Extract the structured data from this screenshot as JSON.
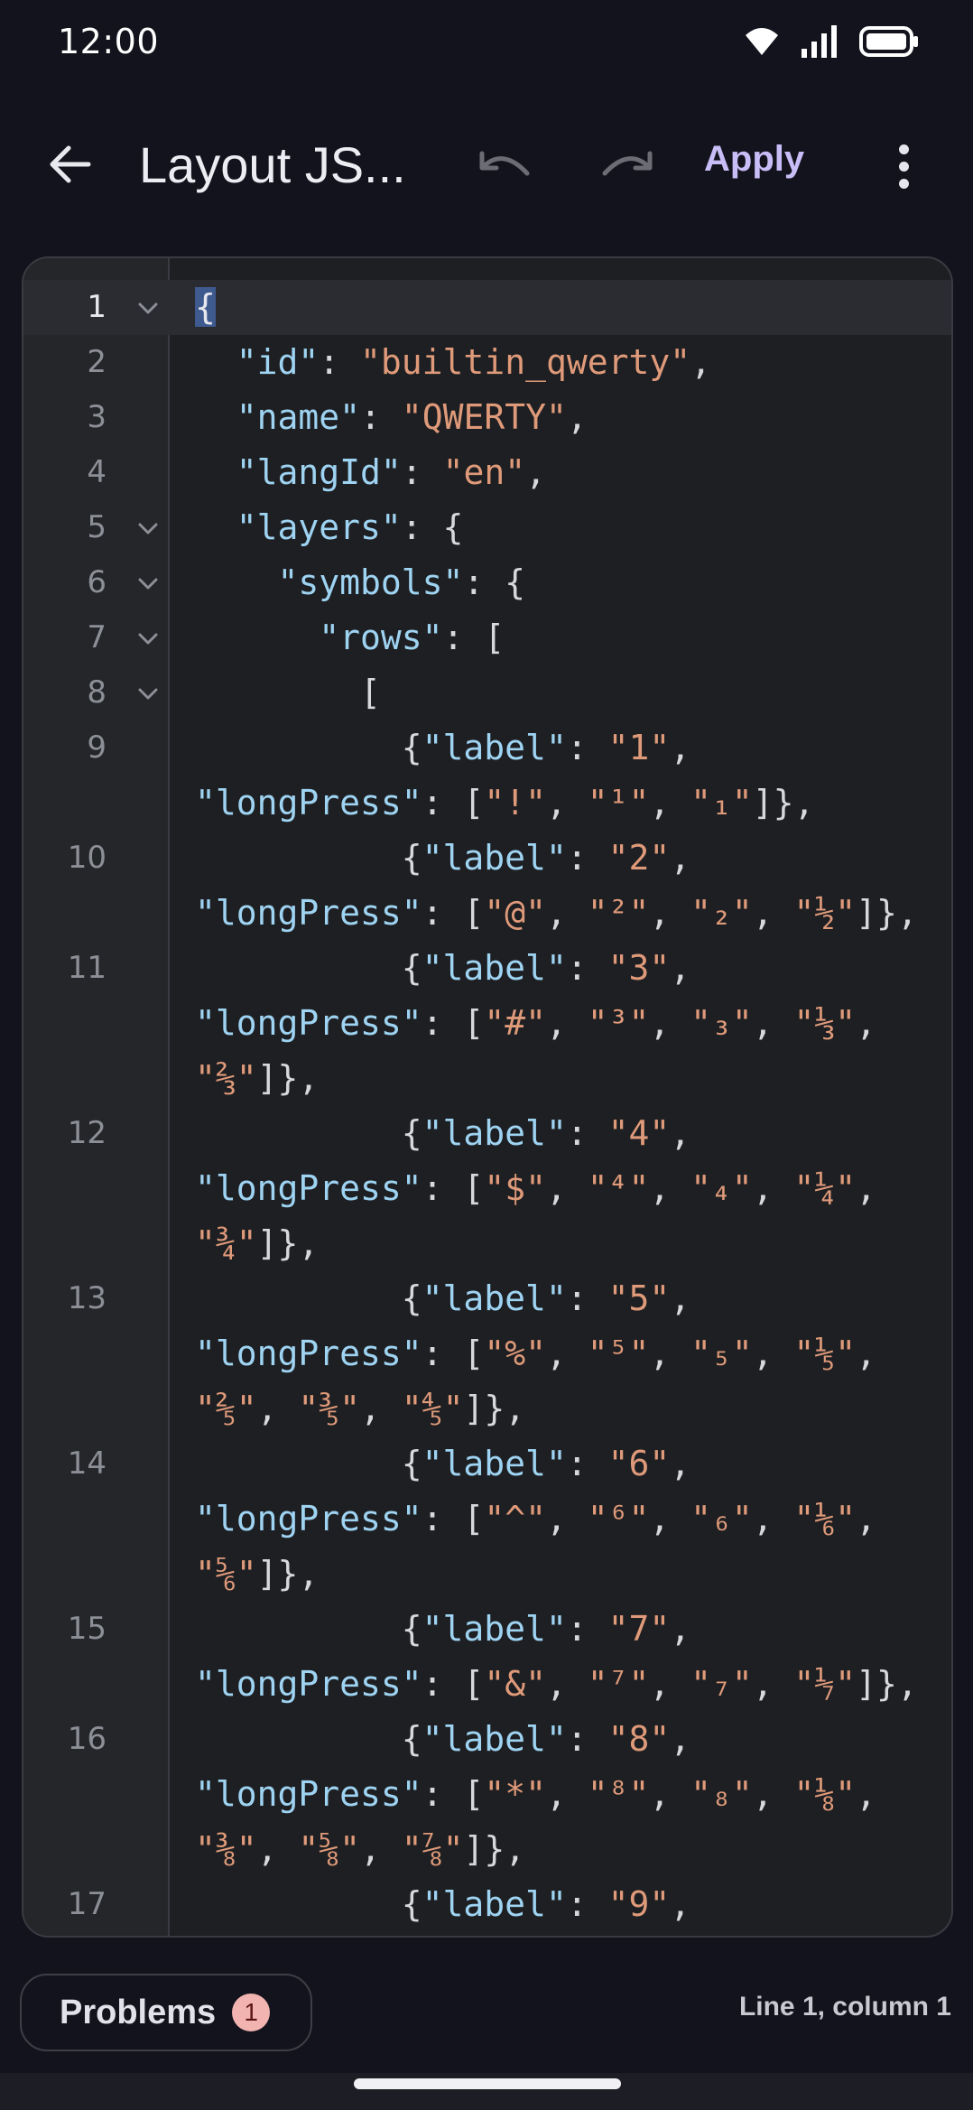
{
  "status_bar": {
    "time": "12:00",
    "icons": [
      "wifi-icon",
      "signal-icon",
      "battery-icon"
    ]
  },
  "app_bar": {
    "title": "Layout JS...",
    "apply_label": "Apply",
    "icons": [
      "arrow-back-icon",
      "undo-icon",
      "redo-icon",
      "more-vertical-icon"
    ]
  },
  "colors": {
    "background": "#13131d",
    "editor_bg": "#1e1f22",
    "gutter_bg": "#25262a",
    "json_key": "#9ed3f2",
    "json_string": "#df9a7a",
    "accent": "#c9bdf7",
    "badge": "#f2b4b0"
  },
  "editor": {
    "lines": [
      {
        "num": "1",
        "fold": true,
        "active": true,
        "wrapped_rows": 1,
        "tokens": [
          {
            "t": "{",
            "c": "caret"
          }
        ]
      },
      {
        "num": "2",
        "fold": false,
        "wrapped_rows": 1,
        "tokens": [
          {
            "t": "  ",
            "c": "p"
          },
          {
            "t": "\"id\"",
            "c": "k"
          },
          {
            "t": ": ",
            "c": "p"
          },
          {
            "t": "\"builtin_qwerty\"",
            "c": "s"
          },
          {
            "t": ",",
            "c": "p"
          }
        ]
      },
      {
        "num": "3",
        "fold": false,
        "wrapped_rows": 1,
        "tokens": [
          {
            "t": "  ",
            "c": "p"
          },
          {
            "t": "\"name\"",
            "c": "k"
          },
          {
            "t": ": ",
            "c": "p"
          },
          {
            "t": "\"QWERTY\"",
            "c": "s"
          },
          {
            "t": ",",
            "c": "p"
          }
        ]
      },
      {
        "num": "4",
        "fold": false,
        "wrapped_rows": 1,
        "tokens": [
          {
            "t": "  ",
            "c": "p"
          },
          {
            "t": "\"langId\"",
            "c": "k"
          },
          {
            "t": ": ",
            "c": "p"
          },
          {
            "t": "\"en\"",
            "c": "s"
          },
          {
            "t": ",",
            "c": "p"
          }
        ]
      },
      {
        "num": "5",
        "fold": true,
        "wrapped_rows": 1,
        "tokens": [
          {
            "t": "  ",
            "c": "p"
          },
          {
            "t": "\"layers\"",
            "c": "k"
          },
          {
            "t": ": {",
            "c": "p"
          }
        ]
      },
      {
        "num": "6",
        "fold": true,
        "wrapped_rows": 1,
        "tokens": [
          {
            "t": "    ",
            "c": "p"
          },
          {
            "t": "\"symbols\"",
            "c": "k"
          },
          {
            "t": ": {",
            "c": "p"
          }
        ]
      },
      {
        "num": "7",
        "fold": true,
        "wrapped_rows": 1,
        "tokens": [
          {
            "t": "      ",
            "c": "p"
          },
          {
            "t": "\"rows\"",
            "c": "k"
          },
          {
            "t": ": [",
            "c": "p"
          }
        ]
      },
      {
        "num": "8",
        "fold": true,
        "wrapped_rows": 1,
        "tokens": [
          {
            "t": "        [",
            "c": "p"
          }
        ]
      },
      {
        "num": "9",
        "fold": false,
        "wrapped_rows": 2,
        "tokens": [
          {
            "t": "          {",
            "c": "p"
          },
          {
            "t": "\"label\"",
            "c": "k"
          },
          {
            "t": ": ",
            "c": "p"
          },
          {
            "t": "\"1\"",
            "c": "s"
          },
          {
            "t": ", ",
            "c": "p"
          },
          {
            "t": "\"longPress\"",
            "c": "k"
          },
          {
            "t": ": [",
            "c": "p"
          },
          {
            "t": "\"!\"",
            "c": "s"
          },
          {
            "t": ", ",
            "c": "p"
          },
          {
            "t": "\"¹\"",
            "c": "s"
          },
          {
            "t": ", ",
            "c": "p"
          },
          {
            "t": "\"₁\"",
            "c": "s"
          },
          {
            "t": "]},",
            "c": "p"
          }
        ]
      },
      {
        "num": "10",
        "fold": false,
        "wrapped_rows": 2,
        "tokens": [
          {
            "t": "          {",
            "c": "p"
          },
          {
            "t": "\"label\"",
            "c": "k"
          },
          {
            "t": ": ",
            "c": "p"
          },
          {
            "t": "\"2\"",
            "c": "s"
          },
          {
            "t": ", ",
            "c": "p"
          },
          {
            "t": "\"longPress\"",
            "c": "k"
          },
          {
            "t": ": [",
            "c": "p"
          },
          {
            "t": "\"@\"",
            "c": "s"
          },
          {
            "t": ", ",
            "c": "p"
          },
          {
            "t": "\"²\"",
            "c": "s"
          },
          {
            "t": ", ",
            "c": "p"
          },
          {
            "t": "\"₂\"",
            "c": "s"
          },
          {
            "t": ", ",
            "c": "p"
          },
          {
            "t": "\"½\"",
            "c": "s"
          },
          {
            "t": "]},",
            "c": "p"
          }
        ]
      },
      {
        "num": "11",
        "fold": false,
        "wrapped_rows": 3,
        "tokens": [
          {
            "t": "          {",
            "c": "p"
          },
          {
            "t": "\"label\"",
            "c": "k"
          },
          {
            "t": ": ",
            "c": "p"
          },
          {
            "t": "\"3\"",
            "c": "s"
          },
          {
            "t": ", ",
            "c": "p"
          },
          {
            "t": "\"longPress\"",
            "c": "k"
          },
          {
            "t": ": [",
            "c": "p"
          },
          {
            "t": "\"#\"",
            "c": "s"
          },
          {
            "t": ", ",
            "c": "p"
          },
          {
            "t": "\"³\"",
            "c": "s"
          },
          {
            "t": ", ",
            "c": "p"
          },
          {
            "t": "\"₃\"",
            "c": "s"
          },
          {
            "t": ", ",
            "c": "p"
          },
          {
            "t": "\"⅓\"",
            "c": "s"
          },
          {
            "t": ", ",
            "c": "p"
          },
          {
            "t": "\"⅔\"",
            "c": "s"
          },
          {
            "t": "]},",
            "c": "p"
          }
        ]
      },
      {
        "num": "12",
        "fold": false,
        "wrapped_rows": 3,
        "tokens": [
          {
            "t": "          {",
            "c": "p"
          },
          {
            "t": "\"label\"",
            "c": "k"
          },
          {
            "t": ": ",
            "c": "p"
          },
          {
            "t": "\"4\"",
            "c": "s"
          },
          {
            "t": ", ",
            "c": "p"
          },
          {
            "t": "\"longPress\"",
            "c": "k"
          },
          {
            "t": ": [",
            "c": "p"
          },
          {
            "t": "\"$\"",
            "c": "s"
          },
          {
            "t": ", ",
            "c": "p"
          },
          {
            "t": "\"⁴\"",
            "c": "s"
          },
          {
            "t": ", ",
            "c": "p"
          },
          {
            "t": "\"₄\"",
            "c": "s"
          },
          {
            "t": ", ",
            "c": "p"
          },
          {
            "t": "\"¼\"",
            "c": "s"
          },
          {
            "t": ", ",
            "c": "p"
          },
          {
            "t": "\"¾\"",
            "c": "s"
          },
          {
            "t": "]},",
            "c": "p"
          }
        ]
      },
      {
        "num": "13",
        "fold": false,
        "wrapped_rows": 3,
        "tokens": [
          {
            "t": "          {",
            "c": "p"
          },
          {
            "t": "\"label\"",
            "c": "k"
          },
          {
            "t": ": ",
            "c": "p"
          },
          {
            "t": "\"5\"",
            "c": "s"
          },
          {
            "t": ", ",
            "c": "p"
          },
          {
            "t": "\"longPress\"",
            "c": "k"
          },
          {
            "t": ": [",
            "c": "p"
          },
          {
            "t": "\"%\"",
            "c": "s"
          },
          {
            "t": ", ",
            "c": "p"
          },
          {
            "t": "\"⁵\"",
            "c": "s"
          },
          {
            "t": ", ",
            "c": "p"
          },
          {
            "t": "\"₅\"",
            "c": "s"
          },
          {
            "t": ", ",
            "c": "p"
          },
          {
            "t": "\"⅕\"",
            "c": "s"
          },
          {
            "t": ", ",
            "c": "p"
          },
          {
            "t": "\"⅖\"",
            "c": "s"
          },
          {
            "t": ", ",
            "c": "p"
          },
          {
            "t": "\"⅗\"",
            "c": "s"
          },
          {
            "t": ", ",
            "c": "p"
          },
          {
            "t": "\"⅘\"",
            "c": "s"
          },
          {
            "t": "]},",
            "c": "p"
          }
        ]
      },
      {
        "num": "14",
        "fold": false,
        "wrapped_rows": 3,
        "tokens": [
          {
            "t": "          {",
            "c": "p"
          },
          {
            "t": "\"label\"",
            "c": "k"
          },
          {
            "t": ": ",
            "c": "p"
          },
          {
            "t": "\"6\"",
            "c": "s"
          },
          {
            "t": ", ",
            "c": "p"
          },
          {
            "t": "\"longPress\"",
            "c": "k"
          },
          {
            "t": ": [",
            "c": "p"
          },
          {
            "t": "\"^\"",
            "c": "s"
          },
          {
            "t": ", ",
            "c": "p"
          },
          {
            "t": "\"⁶\"",
            "c": "s"
          },
          {
            "t": ", ",
            "c": "p"
          },
          {
            "t": "\"₆\"",
            "c": "s"
          },
          {
            "t": ", ",
            "c": "p"
          },
          {
            "t": "\"⅙\"",
            "c": "s"
          },
          {
            "t": ", ",
            "c": "p"
          },
          {
            "t": "\"⅚\"",
            "c": "s"
          },
          {
            "t": "]},",
            "c": "p"
          }
        ]
      },
      {
        "num": "15",
        "fold": false,
        "wrapped_rows": 2,
        "tokens": [
          {
            "t": "          {",
            "c": "p"
          },
          {
            "t": "\"label\"",
            "c": "k"
          },
          {
            "t": ": ",
            "c": "p"
          },
          {
            "t": "\"7\"",
            "c": "s"
          },
          {
            "t": ", ",
            "c": "p"
          },
          {
            "t": "\"longPress\"",
            "c": "k"
          },
          {
            "t": ": [",
            "c": "p"
          },
          {
            "t": "\"&\"",
            "c": "s"
          },
          {
            "t": ", ",
            "c": "p"
          },
          {
            "t": "\"⁷\"",
            "c": "s"
          },
          {
            "t": ", ",
            "c": "p"
          },
          {
            "t": "\"₇\"",
            "c": "s"
          },
          {
            "t": ", ",
            "c": "p"
          },
          {
            "t": "\"⅐\"",
            "c": "s"
          },
          {
            "t": "]},",
            "c": "p"
          }
        ]
      },
      {
        "num": "16",
        "fold": false,
        "wrapped_rows": 3,
        "tokens": [
          {
            "t": "          {",
            "c": "p"
          },
          {
            "t": "\"label\"",
            "c": "k"
          },
          {
            "t": ": ",
            "c": "p"
          },
          {
            "t": "\"8\"",
            "c": "s"
          },
          {
            "t": ", ",
            "c": "p"
          },
          {
            "t": "\"longPress\"",
            "c": "k"
          },
          {
            "t": ": [",
            "c": "p"
          },
          {
            "t": "\"*\"",
            "c": "s"
          },
          {
            "t": ", ",
            "c": "p"
          },
          {
            "t": "\"⁸\"",
            "c": "s"
          },
          {
            "t": ", ",
            "c": "p"
          },
          {
            "t": "\"₈\"",
            "c": "s"
          },
          {
            "t": ", ",
            "c": "p"
          },
          {
            "t": "\"⅛\"",
            "c": "s"
          },
          {
            "t": ", ",
            "c": "p"
          },
          {
            "t": "\"⅜\"",
            "c": "s"
          },
          {
            "t": ", ",
            "c": "p"
          },
          {
            "t": "\"⅝\"",
            "c": "s"
          },
          {
            "t": ", ",
            "c": "p"
          },
          {
            "t": "\"⅞\"",
            "c": "s"
          },
          {
            "t": "]},",
            "c": "p"
          }
        ]
      },
      {
        "num": "17",
        "fold": false,
        "wrapped_rows": 1,
        "tokens": [
          {
            "t": "          {",
            "c": "p"
          },
          {
            "t": "\"label\"",
            "c": "k"
          },
          {
            "t": ": ",
            "c": "p"
          },
          {
            "t": "\"9\"",
            "c": "s"
          },
          {
            "t": ",",
            "c": "p"
          }
        ]
      }
    ]
  },
  "bottom_bar": {
    "problems_label": "Problems",
    "problems_count": "1",
    "cursor_position": "Line 1, column 1"
  }
}
